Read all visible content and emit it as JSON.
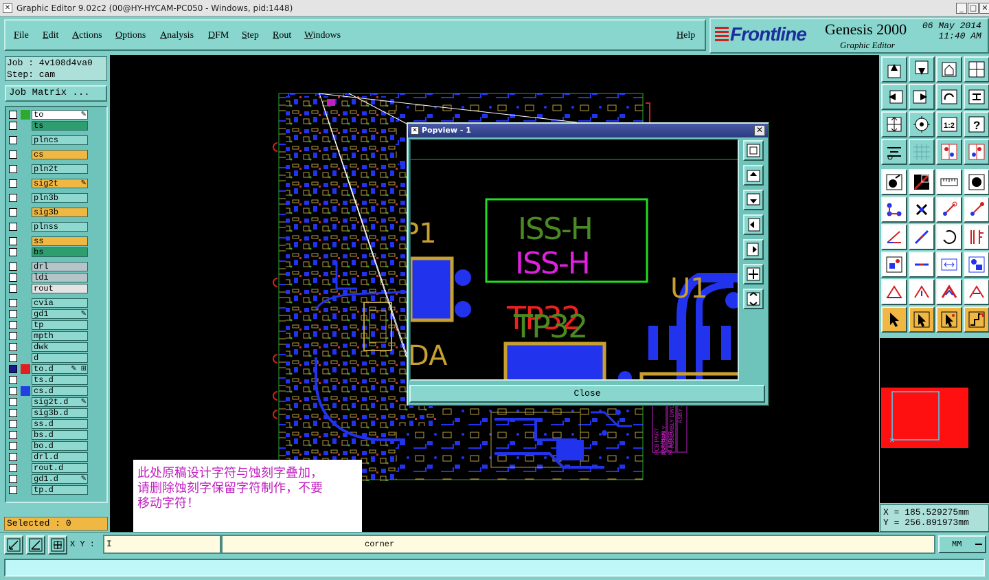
{
  "window": {
    "title": "Graphic Editor 9.02c2 (00@HY-HYCAM-PC050 - Windows, pid:1448)",
    "min": "_",
    "max": "□",
    "close": "✕"
  },
  "menu": {
    "items": [
      "File",
      "Edit",
      "Actions",
      "Options",
      "Analysis",
      "DFM",
      "Step",
      "Rout",
      "Windows"
    ],
    "help": "Help"
  },
  "brand": {
    "logo": "Frontline",
    "product": "Genesis 2000",
    "subtitle": "Graphic Editor",
    "date": "06 May 2014",
    "time": "11:40 AM"
  },
  "job": {
    "job_line": "Job : 4v108d4va0",
    "step_line": "Step: cam",
    "matrix_button": "Job Matrix ..."
  },
  "layers": [
    {
      "name": "to",
      "color": "#ffffff",
      "chip": "#2ea82e",
      "mark": "✎",
      "checked": false
    },
    {
      "name": "ts",
      "color": "#2e9e6e",
      "chip": "",
      "mark": "",
      "checked": false
    },
    {
      "name": "plncs",
      "color": "#8fd8cf",
      "chip": "",
      "mark": "",
      "checked": false
    },
    {
      "name": "cs",
      "color": "#f0b842",
      "chip": "",
      "mark": "",
      "checked": false
    },
    {
      "name": "pln2t",
      "color": "#8fd8cf",
      "chip": "",
      "mark": "",
      "checked": false
    },
    {
      "name": "sig2t",
      "color": "#f0b842",
      "chip": "",
      "mark": "✎",
      "checked": false
    },
    {
      "name": "pln3b",
      "color": "#8fd8cf",
      "chip": "",
      "mark": "",
      "checked": false
    },
    {
      "name": "sig3b",
      "color": "#f0b842",
      "chip": "",
      "mark": "",
      "checked": false
    },
    {
      "name": "plnss",
      "color": "#8fd8cf",
      "chip": "",
      "mark": "",
      "checked": false
    },
    {
      "name": "ss",
      "color": "#f0b842",
      "chip": "",
      "mark": "",
      "checked": false
    },
    {
      "name": "bs",
      "color": "#2e9e6e",
      "chip": "",
      "mark": "",
      "checked": false
    },
    {
      "name": "drl",
      "color": "#b4c4c8",
      "chip": "",
      "mark": "",
      "checked": false
    },
    {
      "name": "ldi",
      "color": "#b4c4c8",
      "chip": "",
      "mark": "",
      "checked": false
    },
    {
      "name": "rout",
      "color": "#e4e4e4",
      "chip": "",
      "mark": "",
      "checked": false
    },
    {
      "name": "cvia",
      "color": "#8fd8cf",
      "chip": "",
      "mark": "",
      "checked": false
    },
    {
      "name": "gd1",
      "color": "#8fd8cf",
      "chip": "",
      "mark": "✎",
      "checked": false
    },
    {
      "name": "tp",
      "color": "#8fd8cf",
      "chip": "",
      "mark": "",
      "checked": false
    },
    {
      "name": "mpth",
      "color": "#8fd8cf",
      "chip": "",
      "mark": "",
      "checked": false
    },
    {
      "name": "dwk",
      "color": "#8fd8cf",
      "chip": "",
      "mark": "",
      "checked": false
    },
    {
      "name": "d",
      "color": "#8fd8cf",
      "chip": "",
      "mark": "",
      "checked": false
    },
    {
      "name": "to.d",
      "color": "#8fd8cf",
      "chip": "#e02020",
      "mark": "✎ ⊞",
      "checked": true
    },
    {
      "name": "ts.d",
      "color": "#8fd8cf",
      "chip": "",
      "mark": "",
      "checked": false
    },
    {
      "name": "cs.d",
      "color": "#8fd8cf",
      "chip": "#2040e0",
      "mark": "",
      "checked": false
    },
    {
      "name": "sig2t.d",
      "color": "#8fd8cf",
      "chip": "",
      "mark": "✎",
      "checked": false
    },
    {
      "name": "sig3b.d",
      "color": "#8fd8cf",
      "chip": "",
      "mark": "",
      "checked": false
    },
    {
      "name": "ss.d",
      "color": "#8fd8cf",
      "chip": "",
      "mark": "",
      "checked": false
    },
    {
      "name": "bs.d",
      "color": "#8fd8cf",
      "chip": "",
      "mark": "",
      "checked": false
    },
    {
      "name": "bo.d",
      "color": "#8fd8cf",
      "chip": "",
      "mark": "",
      "checked": false
    },
    {
      "name": "drl.d",
      "color": "#8fd8cf",
      "chip": "",
      "mark": "",
      "checked": false
    },
    {
      "name": "rout.d",
      "color": "#8fd8cf",
      "chip": "",
      "mark": "",
      "checked": false
    },
    {
      "name": "gd1.d",
      "color": "#8fd8cf",
      "chip": "",
      "mark": "✎",
      "checked": false
    },
    {
      "name": "tp.d",
      "color": "#8fd8cf",
      "chip": "",
      "mark": "",
      "checked": false
    }
  ],
  "selected": "Selected : 0",
  "annotation": {
    "line1": "此处原稿设计字符与蚀刻字叠加，",
    "line2": "请删除蚀刻字保留字符制作，不要",
    "line3": "移动字符！"
  },
  "popview": {
    "title": "Popview - 1",
    "close_label": "Close",
    "labels": {
      "iss_green": "ISS-H",
      "iss_magenta": "ISS-H",
      "tp_red": "TP32",
      "tp_green": "TP32",
      "u1": "U1",
      "p1": "P1",
      "da": "DA"
    }
  },
  "board_silk": [
    "PCB PART NUMBER",
    "ASSEMBLY NUMBER",
    "ASSEMBLY DWG",
    "ASBY 1"
  ],
  "coords": {
    "x": "X = 185.529275mm",
    "y": "Y = 256.891973mm"
  },
  "bottom": {
    "xy_label": "X Y :",
    "xy_value": "I",
    "message": "corner",
    "unit": "MM"
  },
  "status": ""
}
